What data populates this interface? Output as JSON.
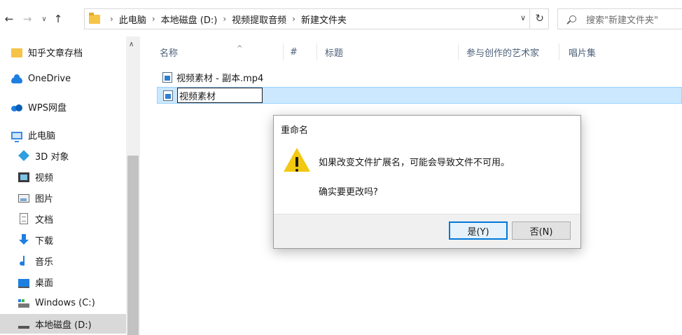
{
  "address_bar": {
    "back_icon": "arrow-left-icon",
    "forward_icon": "arrow-right-icon",
    "recent_icon": "chevron-down-icon",
    "up_icon": "arrow-up-icon",
    "path": [
      "此电脑",
      "本地磁盘 (D:)",
      "视频提取音频",
      "新建文件夹"
    ],
    "search_placeholder": "搜索\"新建文件夹\""
  },
  "nav_pane": {
    "items": [
      {
        "label": "知乎文章存档",
        "icon": "folder-icon"
      },
      {
        "label": "OneDrive",
        "icon": "onedrive-cloud-icon"
      },
      {
        "label": "WPS网盘",
        "icon": "wps-cloud-icon"
      },
      {
        "label": "此电脑",
        "icon": "computer-icon"
      },
      {
        "label": "3D 对象",
        "icon": "3d-objects-icon"
      },
      {
        "label": "视频",
        "icon": "video-icon"
      },
      {
        "label": "图片",
        "icon": "picture-icon"
      },
      {
        "label": "文档",
        "icon": "document-icon"
      },
      {
        "label": "下载",
        "icon": "download-icon"
      },
      {
        "label": "音乐",
        "icon": "music-icon"
      },
      {
        "label": "桌面",
        "icon": "desktop-icon"
      },
      {
        "label": "Windows (C:)",
        "icon": "drive-c-icon"
      },
      {
        "label": "本地磁盘 (D:)",
        "icon": "drive-d-icon",
        "selected": true
      }
    ]
  },
  "columns": [
    "名称",
    "#",
    "标题",
    "参与创作的艺术家",
    "唱片集"
  ],
  "files": [
    {
      "name": "视频素材 - 副本.mp4",
      "icon": "video-file-icon"
    },
    {
      "name": "视频素材",
      "icon": "video-file-icon",
      "renaming": true
    }
  ],
  "dialog": {
    "title": "重命名",
    "icon": "warning-icon",
    "message": "如果改变文件扩展名，可能会导致文件不可用。",
    "question": "确实要更改吗?",
    "yes_label": "是(Y)",
    "no_label": "否(N)"
  },
  "colors": {
    "selection_bg": "#cce8ff",
    "selection_border": "#99d1ff",
    "accent": "#0078d7",
    "warning": "#f2c811",
    "column_header": "#4c607a"
  }
}
